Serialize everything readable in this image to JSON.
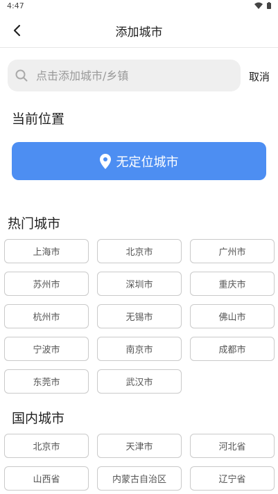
{
  "status_bar": {
    "time": "4:47"
  },
  "header": {
    "title": "添加城市"
  },
  "search": {
    "placeholder": "点击添加城市/乡镇",
    "cancel_label": "取消"
  },
  "location": {
    "heading": "当前位置",
    "button_label": "无定位城市"
  },
  "hot_cities": {
    "heading": "热门城市",
    "items": [
      "上海市",
      "北京市",
      "广州市",
      "苏州市",
      "深圳市",
      "重庆市",
      "杭州市",
      "无锡市",
      "佛山市",
      "宁波市",
      "南京市",
      "成都市",
      "东莞市",
      "武汉市"
    ]
  },
  "domestic_cities": {
    "heading": "国内城市",
    "items": [
      "北京市",
      "天津市",
      "河北省",
      "山西省",
      "内蒙古自治区",
      "辽宁省"
    ]
  },
  "colors": {
    "accent": "#4d8ef2",
    "search_bg": "#efefef",
    "chip_border": "#c9c9c9"
  }
}
